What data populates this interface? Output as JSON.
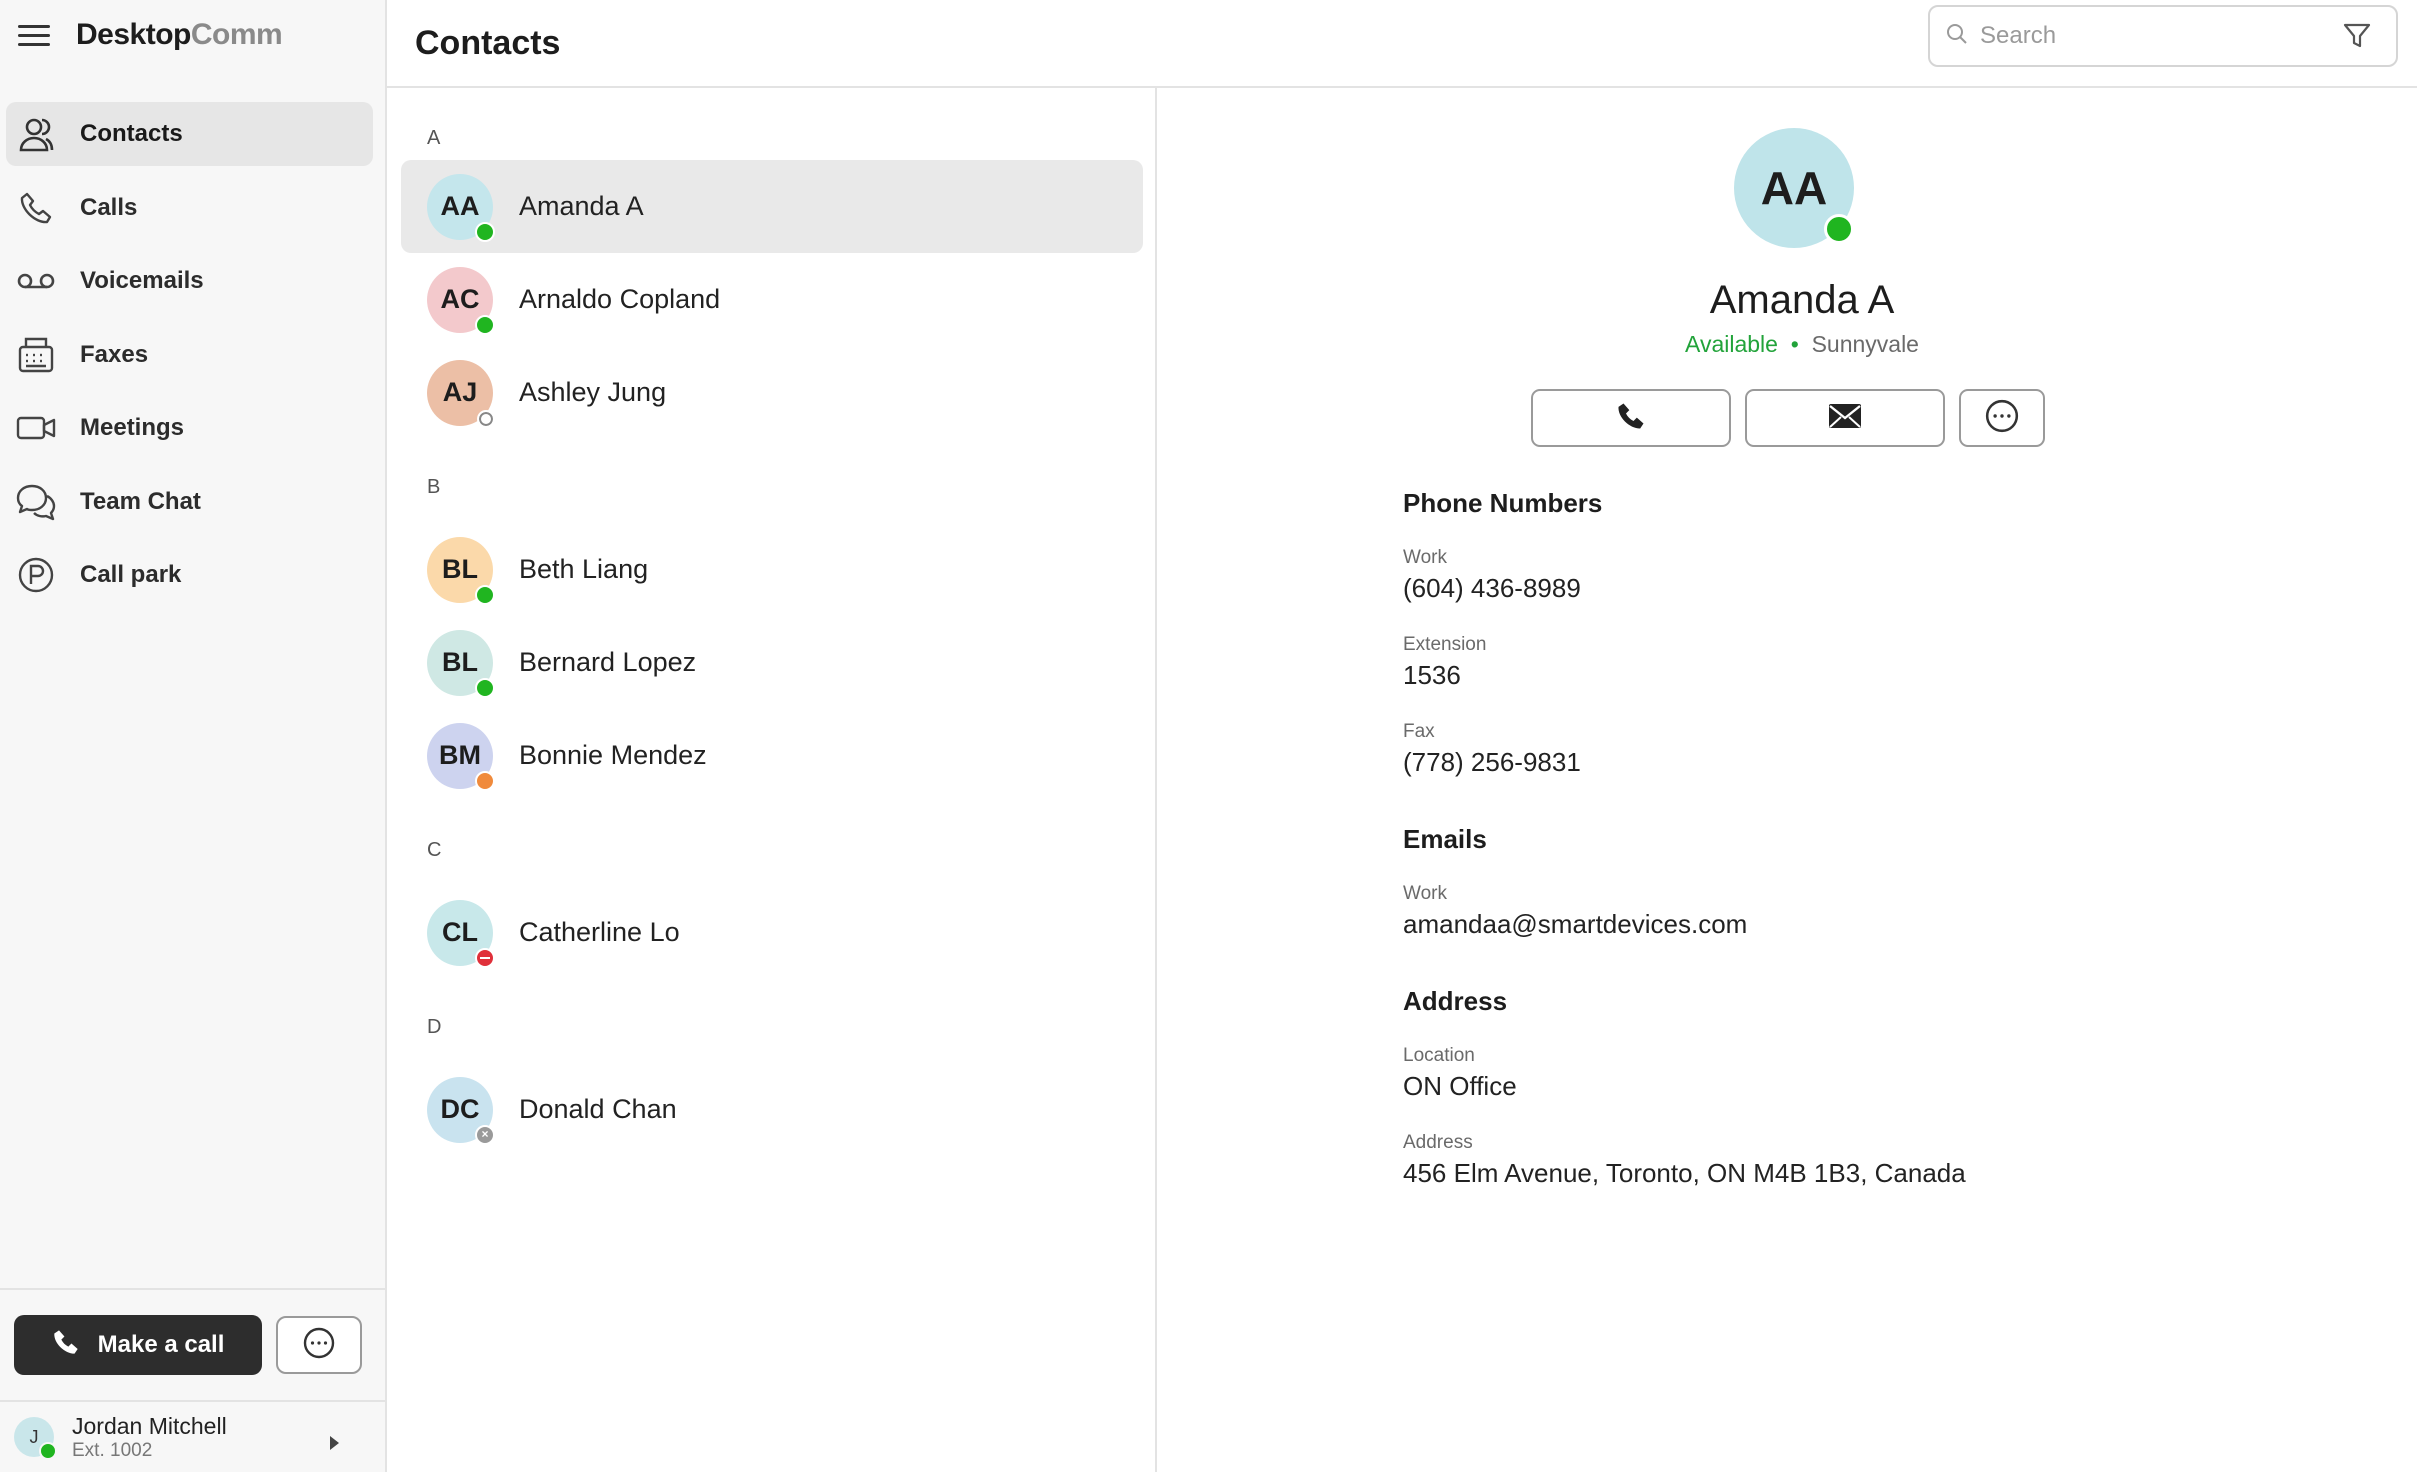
{
  "app": {
    "brand_main": "Desktop",
    "brand_light": "Comm"
  },
  "sidebar": {
    "items": [
      {
        "label": "Contacts",
        "icon": "contacts-icon",
        "active": true
      },
      {
        "label": "Calls",
        "icon": "phone-icon"
      },
      {
        "label": "Voicemails",
        "icon": "voicemail-icon"
      },
      {
        "label": "Faxes",
        "icon": "fax-icon"
      },
      {
        "label": "Meetings",
        "icon": "video-camera-icon"
      },
      {
        "label": "Team Chat",
        "icon": "chat-bubbles-icon"
      },
      {
        "label": "Call park",
        "icon": "parking-icon"
      }
    ],
    "make_call_label": "Make a call",
    "user": {
      "initial": "J",
      "name": "Jordan Mitchell",
      "ext": "Ext. 1002"
    }
  },
  "header": {
    "title": "Contacts",
    "search_placeholder": "Search"
  },
  "contacts": {
    "sections": [
      {
        "letter": "A",
        "items": [
          {
            "initials": "AA",
            "name": "Amanda A",
            "bg": "#c4e6ec",
            "status": "available"
          },
          {
            "initials": "AC",
            "name": "Arnaldo Copland",
            "bg": "#f3c9cc",
            "status": "available"
          },
          {
            "initials": "AJ",
            "name": "Ashley Jung",
            "bg": "#ecbfa6",
            "status": "offline"
          }
        ]
      },
      {
        "letter": "B",
        "items": [
          {
            "initials": "BL",
            "name": "Beth Liang",
            "bg": "#fbd9aa",
            "status": "available"
          },
          {
            "initials": "BL",
            "name": "Bernard Lopez",
            "bg": "#cfe8e4",
            "status": "available"
          },
          {
            "initials": "BM",
            "name": "Bonnie Mendez",
            "bg": "#cdd3ef",
            "status": "away"
          }
        ]
      },
      {
        "letter": "C",
        "items": [
          {
            "initials": "CL",
            "name": "Catherline Lo",
            "bg": "#c8e8ea",
            "status": "busy"
          }
        ]
      },
      {
        "letter": "D",
        "items": [
          {
            "initials": "DC",
            "name": "Donald Chan",
            "bg": "#c9e3ef",
            "status": "unavailable"
          }
        ]
      }
    ]
  },
  "detail": {
    "initials": "AA",
    "name": "Amanda A",
    "status": "Available",
    "location": "Sunnyvale",
    "phone_section": "Phone Numbers",
    "work_label": "Work",
    "work_phone": "(604) 436-8989",
    "ext_label": "Extension",
    "ext_value": "1536",
    "fax_label": "Fax",
    "fax_value": "(778) 256-9831",
    "emails_section": "Emails",
    "email_label": "Work",
    "email_value": "amandaa@smartdevices.com",
    "address_section": "Address",
    "location_label": "Location",
    "location_value": "ON Office",
    "address_label": "Address",
    "address_value": "456 Elm Avenue, Toronto, ON M4B 1B3, Canada"
  },
  "colors": {
    "available": "#20b520",
    "busy": "#e0303a",
    "away": "#f08a3c",
    "offline": "#888888",
    "accent_green": "#22a33a"
  }
}
